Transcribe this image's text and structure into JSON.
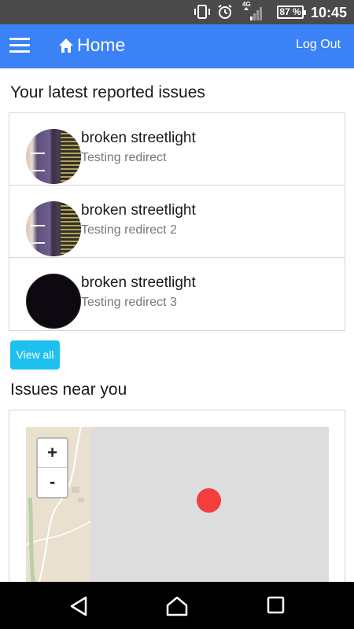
{
  "status_bar": {
    "network": "4G",
    "battery": "87 %",
    "time": "10:45"
  },
  "app_bar": {
    "title": "Home",
    "logout_label": "Log Out"
  },
  "latest_section": {
    "heading": "Your latest reported issues",
    "issues": [
      {
        "title": "broken streetlight",
        "subtitle": "Testing redirect"
      },
      {
        "title": "broken streetlight",
        "subtitle": "Testing redirect 2"
      },
      {
        "title": "broken streetlight",
        "subtitle": "Testing redirect 3"
      }
    ],
    "view_all_label": "View all"
  },
  "near_section": {
    "heading": "Issues near you",
    "zoom_in_label": "+",
    "zoom_out_label": "-"
  },
  "colors": {
    "app_bar": "#3b82f6",
    "view_all_button": "#1ec0f0",
    "marker": "#f43d3d"
  }
}
